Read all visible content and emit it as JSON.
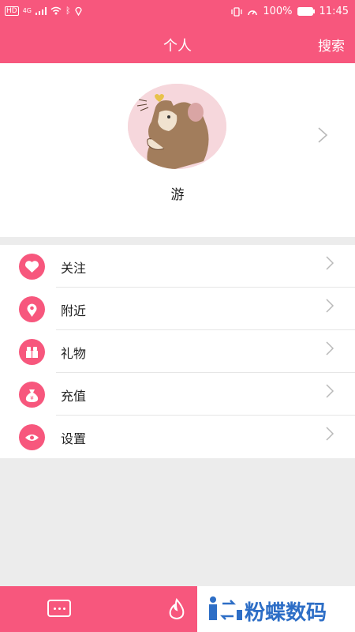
{
  "statusbar": {
    "left": [
      "HD",
      "4G"
    ],
    "battery": "100%",
    "time": "11:45"
  },
  "header": {
    "title": "个人",
    "search_label": "搜索"
  },
  "profile": {
    "name": "游"
  },
  "menu": {
    "items": [
      {
        "label": "关注",
        "icon": "heart-icon"
      },
      {
        "label": "附近",
        "icon": "location-pin-icon"
      },
      {
        "label": "礼物",
        "icon": "gift-icon"
      },
      {
        "label": "充值",
        "icon": "money-bag-icon"
      },
      {
        "label": "设置",
        "icon": "settings-eye-icon"
      }
    ]
  },
  "bottom_nav": {
    "items": [
      {
        "icon": "chat-bubble-icon"
      },
      {
        "icon": "flame-icon"
      }
    ]
  },
  "watermark": {
    "text": "粉蝶数码"
  },
  "colors": {
    "accent": "#f7577d",
    "background": "#ececec"
  }
}
